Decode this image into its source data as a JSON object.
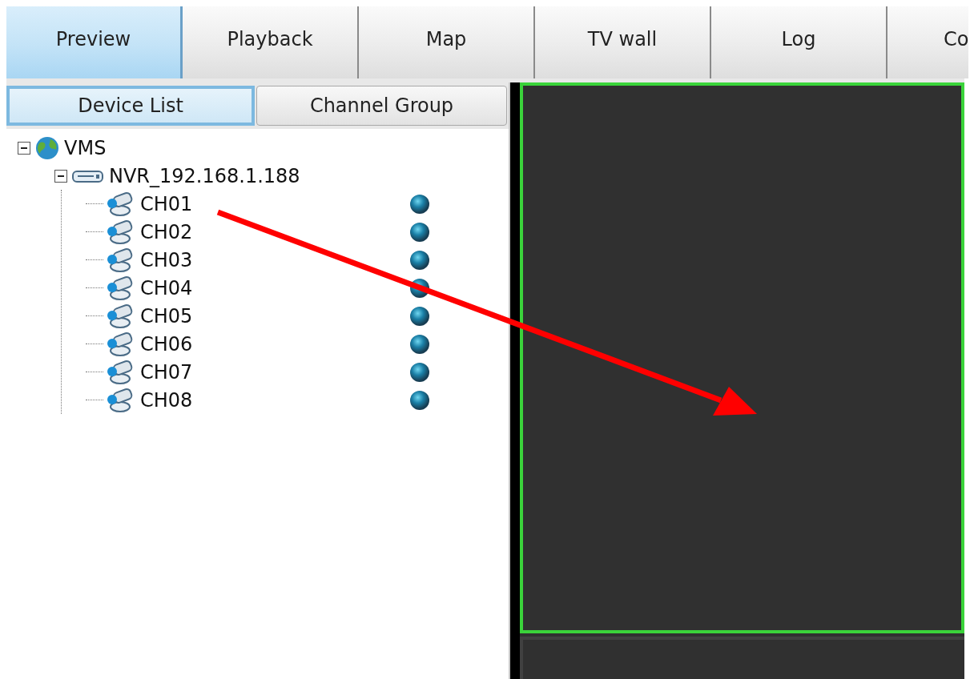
{
  "tabs": [
    {
      "label": "Preview",
      "selected": true
    },
    {
      "label": "Playback",
      "selected": false
    },
    {
      "label": "Map",
      "selected": false
    },
    {
      "label": "TV wall",
      "selected": false
    },
    {
      "label": "Log",
      "selected": false
    },
    {
      "label": "Co",
      "selected": false
    }
  ],
  "sidebar": {
    "tabs": [
      {
        "label": "Device List",
        "selected": true
      },
      {
        "label": "Channel Group",
        "selected": false
      }
    ],
    "tree": [
      {
        "label": "VMS",
        "kind": "root",
        "expanded": true,
        "children": [
          {
            "label": "NVR_192.168.1.188",
            "kind": "recorder",
            "expanded": true,
            "children": [
              {
                "label": "CH01",
                "kind": "camera"
              },
              {
                "label": "CH02",
                "kind": "camera"
              },
              {
                "label": "CH03",
                "kind": "camera"
              },
              {
                "label": "CH04",
                "kind": "camera"
              },
              {
                "label": "CH05",
                "kind": "camera"
              },
              {
                "label": "CH06",
                "kind": "camera"
              },
              {
                "label": "CH07",
                "kind": "camera"
              },
              {
                "label": "CH08",
                "kind": "camera"
              }
            ]
          }
        ]
      }
    ]
  },
  "video_grid": {
    "panes": [
      {
        "selected": true
      },
      {
        "selected": false
      }
    ]
  }
}
